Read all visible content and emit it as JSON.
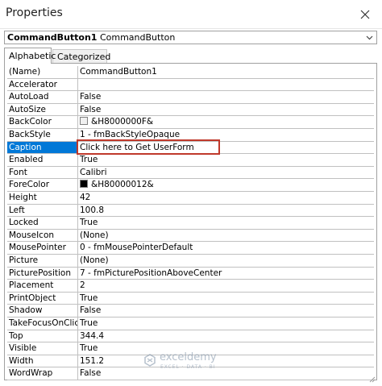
{
  "window": {
    "title": "Properties"
  },
  "selector": {
    "object_name": "CommandButton1",
    "object_type": "CommandButton"
  },
  "tabs": [
    {
      "label": "Alphabetic",
      "active": true
    },
    {
      "label": "Categorized",
      "active": false
    }
  ],
  "properties": [
    {
      "name": "(Name)",
      "value": "CommandButton1"
    },
    {
      "name": "Accelerator",
      "value": ""
    },
    {
      "name": "AutoLoad",
      "value": "False"
    },
    {
      "name": "AutoSize",
      "value": "False"
    },
    {
      "name": "BackColor",
      "value": "&H8000000F&",
      "swatch": "#f0f0f0"
    },
    {
      "name": "BackStyle",
      "value": "1 - fmBackStyleOpaque"
    },
    {
      "name": "Caption",
      "value": "Click here to Get UserForm",
      "selected": true
    },
    {
      "name": "Enabled",
      "value": "True"
    },
    {
      "name": "Font",
      "value": "Calibri"
    },
    {
      "name": "ForeColor",
      "value": "&H80000012&",
      "swatch": "#000000"
    },
    {
      "name": "Height",
      "value": "42"
    },
    {
      "name": "Left",
      "value": "100.8"
    },
    {
      "name": "Locked",
      "value": "True"
    },
    {
      "name": "MouseIcon",
      "value": "(None)"
    },
    {
      "name": "MousePointer",
      "value": "0 - fmMousePointerDefault"
    },
    {
      "name": "Picture",
      "value": "(None)"
    },
    {
      "name": "PicturePosition",
      "value": "7 - fmPicturePositionAboveCenter"
    },
    {
      "name": "Placement",
      "value": "2"
    },
    {
      "name": "PrintObject",
      "value": "True"
    },
    {
      "name": "Shadow",
      "value": "False"
    },
    {
      "name": "TakeFocusOnClick",
      "value": "True"
    },
    {
      "name": "Top",
      "value": "344.4"
    },
    {
      "name": "Visible",
      "value": "True"
    },
    {
      "name": "Width",
      "value": "151.2"
    },
    {
      "name": "WordWrap",
      "value": "False"
    }
  ],
  "watermark": {
    "name": "exceldemy",
    "tagline": "EXCEL · DATA · BI"
  },
  "colors": {
    "selection": "#0078d7",
    "highlight_border": "#c0392b"
  }
}
